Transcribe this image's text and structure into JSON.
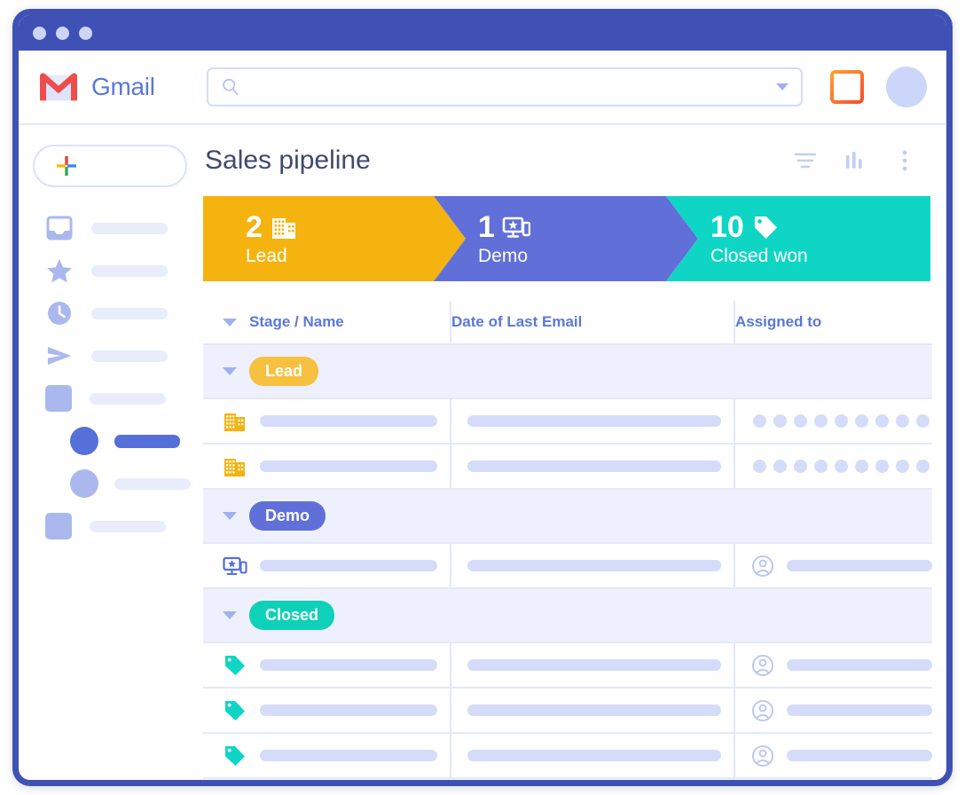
{
  "window": {
    "titlebar_dots": 3,
    "frame_color": "#3f51b5"
  },
  "topbar": {
    "brand": "Gmail",
    "logo_icon": "gmail-m-envelope-icon",
    "search": {
      "value": "",
      "placeholder": "",
      "icon": "search-icon",
      "caret_icon": "chevron-down-icon"
    },
    "apps_icon": "grid-layout-icon",
    "avatar_icon": "user-avatar-icon"
  },
  "sidebar": {
    "compose": {
      "label": "",
      "icon": "plus-icon"
    },
    "items": [
      {
        "icon": "inbox-icon",
        "label": "",
        "active": false,
        "indent": false
      },
      {
        "icon": "star-icon",
        "label": "",
        "active": false,
        "indent": false
      },
      {
        "icon": "clock-snoozed-icon",
        "label": "",
        "active": false,
        "indent": false
      },
      {
        "icon": "send-icon",
        "label": "",
        "active": false,
        "indent": false
      },
      {
        "icon": "square-label-icon",
        "label": "",
        "active": false,
        "indent": false
      },
      {
        "icon": "circle-dot-icon",
        "label": "",
        "active": true,
        "indent": true
      },
      {
        "icon": "circle-dot-icon",
        "label": "",
        "active": false,
        "indent": true
      },
      {
        "icon": "square-label-icon",
        "label": "",
        "active": false,
        "indent": false
      }
    ]
  },
  "main": {
    "title": "Sales pipeline",
    "actions": [
      {
        "name": "filter-icon",
        "label": ""
      },
      {
        "name": "bar-chart-icon",
        "label": ""
      },
      {
        "name": "more-vertical-icon",
        "label": ""
      }
    ]
  },
  "pipeline": {
    "stages": [
      {
        "count": "2",
        "label": "Lead",
        "color": "#f5b310",
        "icon": "office-building-icon"
      },
      {
        "count": "1",
        "label": "Demo",
        "color": "#6070d8",
        "icon": "devices-star-icon"
      },
      {
        "count": "10",
        "label": "Closed won",
        "color": "#0fd6c4",
        "icon": "price-tag-icon"
      }
    ]
  },
  "table": {
    "columns": [
      {
        "label": "Stage / Name",
        "caret": true
      },
      {
        "label": "Date of Last Email",
        "caret": false
      },
      {
        "label": "Assigned to",
        "caret": false
      }
    ],
    "groups": [
      {
        "badge": "Lead",
        "badge_color": "#f7c03f",
        "row_icon": "office-building-icon",
        "row_icon_color": "#f5b310",
        "assigned_style": "dots",
        "assigned_dots": 9,
        "rows": [
          {
            "name": "",
            "date": "",
            "assigned": ""
          },
          {
            "name": "",
            "date": "",
            "assigned": ""
          }
        ]
      },
      {
        "badge": "Demo",
        "badge_color": "#6070d8",
        "row_icon": "devices-star-icon",
        "row_icon_color": "#5570d9",
        "assigned_style": "avatar",
        "assigned_dots": 0,
        "rows": [
          {
            "name": "",
            "date": "",
            "assigned": ""
          }
        ]
      },
      {
        "badge": "Closed",
        "badge_color": "#0fd0b8",
        "row_icon": "price-tag-icon",
        "row_icon_color": "#0fd6c4",
        "assigned_style": "avatar",
        "assigned_dots": 0,
        "rows": [
          {
            "name": "",
            "date": "",
            "assigned": ""
          },
          {
            "name": "",
            "date": "",
            "assigned": ""
          },
          {
            "name": "",
            "date": "",
            "assigned": ""
          }
        ]
      }
    ]
  },
  "colors": {
    "frame": "#3f51b5",
    "brand_blue": "#5a78d8",
    "placeholder": "#d4dcfa",
    "group_row_bg": "#eef1fd",
    "grid_line": "#e3e8fb",
    "amber": "#f5b310",
    "periwinkle": "#6070d8",
    "teal": "#0fd6c4"
  }
}
